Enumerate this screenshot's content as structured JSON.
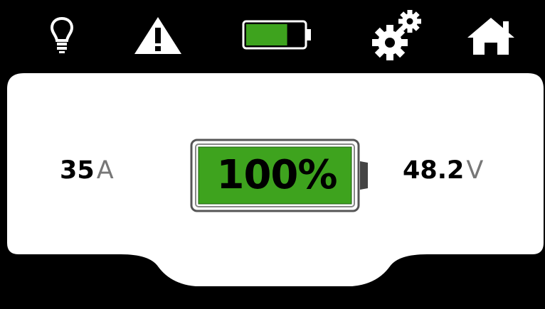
{
  "topbar": {
    "icons": [
      "lightbulb-icon",
      "warning-icon",
      "battery-icon",
      "gears-icon",
      "home-icon"
    ],
    "battery_level": 0.72
  },
  "readings": {
    "current_value": "35",
    "current_unit": "A",
    "voltage_value": "48.2",
    "voltage_unit": "V",
    "charge_percent": "100%",
    "charge_level": 1.0
  },
  "colors": {
    "background": "#000000",
    "panel": "#ffffff",
    "battery_fill": "#3ea31e",
    "battery_outline": "#555555",
    "unit_text": "#777777"
  }
}
